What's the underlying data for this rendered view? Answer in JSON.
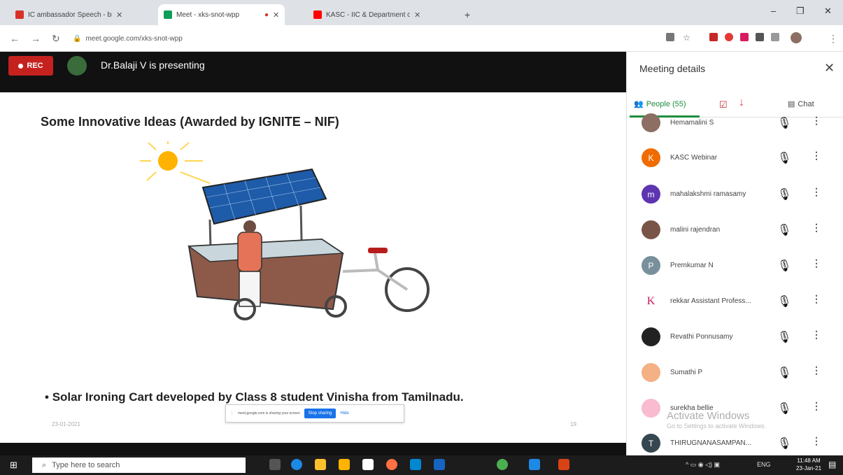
{
  "browser": {
    "tabs": [
      {
        "title": "IC ambassador Speech - broch...",
        "favicon_color": "#d93025",
        "active": false
      },
      {
        "title": "Meet - xks-snot-wpp",
        "favicon_color": "#0f9d58",
        "active": true
      },
      {
        "title": "KASC - IIC & Department of Bio...",
        "favicon_color": "#ff0000",
        "active": false
      }
    ],
    "url": "meet.google.com/xks-snot-wpp"
  },
  "meet": {
    "rec_label": "REC",
    "presenting_text": "Dr.Balaji V is presenting"
  },
  "slide": {
    "title": "Some Innovative Ideas (Awarded by IGNITE – NIF)",
    "bullet": "Solar Ironing Cart developed by Class 8 student Vinisha from Tamilnadu.",
    "date": "23-01-2021",
    "page_number": "19"
  },
  "share_bar": {
    "message": "meet.google.com is sharing your screen",
    "stop_label": "Stop sharing",
    "hide_label": "Hide"
  },
  "panel": {
    "title": "Meeting details",
    "people_tab": "People (55)",
    "chat_tab": "Chat",
    "people": [
      {
        "name": "Hemamalini S",
        "initial": "",
        "color": "#8d6e63"
      },
      {
        "name": "KASC Webinar",
        "initial": "K",
        "color": "#ef6c00"
      },
      {
        "name": "mahalakshmi ramasamy",
        "initial": "m",
        "color": "#5e35b1"
      },
      {
        "name": "malini rajendran",
        "initial": "",
        "color": "#795548"
      },
      {
        "name": "Premkumar N",
        "initial": "P",
        "color": "#78909c"
      },
      {
        "name": "rekkar Assistant Profess...",
        "initial": "K",
        "color": "#ffffff"
      },
      {
        "name": "Revathi Ponnusamy",
        "initial": "",
        "color": "#222222"
      },
      {
        "name": "Sumathi P",
        "initial": "",
        "color": "#f4b183"
      },
      {
        "name": "surekha bellie",
        "initial": "",
        "color": "#f8bbd0"
      },
      {
        "name": "THIRUGNANASAMPAN...",
        "initial": "T",
        "color": "#37474f"
      }
    ],
    "watermark_title": "Activate Windows",
    "watermark_sub": "Go to Settings to activate Windows."
  },
  "taskbar": {
    "search_placeholder": "Type here to search",
    "language": "ENG",
    "time": "11:48 AM",
    "date": "23-Jan-21"
  }
}
